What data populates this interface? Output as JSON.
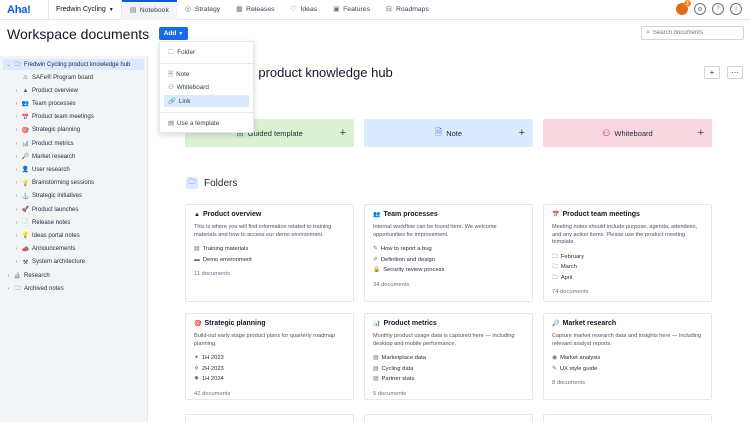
{
  "app": {
    "logo": "Aha!",
    "workspace": "Fredwin Cycling",
    "nav_tabs": [
      {
        "label": "Notebook",
        "icon": "notebook-icon",
        "glyph": "▤"
      },
      {
        "label": "Strategy",
        "icon": "strategy-icon",
        "glyph": "◎"
      },
      {
        "label": "Releases",
        "icon": "releases-icon",
        "glyph": "▦"
      },
      {
        "label": "Ideas",
        "icon": "lightbulb-icon",
        "glyph": "♡"
      },
      {
        "label": "Features",
        "icon": "features-icon",
        "glyph": "▣"
      },
      {
        "label": "Roadmaps",
        "icon": "roadmaps-icon",
        "glyph": "⊟"
      }
    ],
    "notifications_count": "1"
  },
  "header": {
    "title": "Workspace documents",
    "add_label": "Add",
    "search_placeholder": "Search documents"
  },
  "add_menu": {
    "folder": "Folder",
    "note": "Note",
    "whiteboard": "Whiteboard",
    "link": "Link",
    "template": "Use a template"
  },
  "sidebar": {
    "root": "Fredwin Cycling product knowledge hub",
    "items": [
      {
        "label": "SAFe® Program board",
        "glyph": "⚠",
        "color": "#6b7280",
        "chev": ""
      },
      {
        "label": "Product overview",
        "glyph": "▲",
        "color": "#1a6ae6",
        "chev": "›"
      },
      {
        "label": "Team processes",
        "glyph": "👥",
        "color": "#374151",
        "chev": "›"
      },
      {
        "label": "Product team meetings",
        "glyph": "📅",
        "color": "#b45309",
        "chev": "›"
      },
      {
        "label": "Strategic planning",
        "glyph": "🎯",
        "color": "#dc2626",
        "chev": "›"
      },
      {
        "label": "Product metrics",
        "glyph": "📊",
        "color": "#059669",
        "chev": "›"
      },
      {
        "label": "Market research",
        "glyph": "🔎",
        "color": "#374151",
        "chev": "›"
      },
      {
        "label": "User research",
        "glyph": "👤",
        "color": "#374151",
        "chev": "›"
      },
      {
        "label": "Brainstorming sessions",
        "glyph": "💡",
        "color": "#eab308",
        "chev": "›"
      },
      {
        "label": "Strategic initiatives",
        "glyph": "⚓",
        "color": "#374151",
        "chev": "›"
      },
      {
        "label": "Product launches",
        "glyph": "🚀",
        "color": "#dc2626",
        "chev": "›"
      },
      {
        "label": "Release notes",
        "glyph": "📄",
        "color": "#374151",
        "chev": "›"
      },
      {
        "label": "Ideas portal notes",
        "glyph": "💡",
        "color": "#eab308",
        "chev": "›"
      },
      {
        "label": "Announcements",
        "glyph": "📣",
        "color": "#374151",
        "chev": "›"
      },
      {
        "label": "System architecture",
        "glyph": "⚒",
        "color": "#374151",
        "chev": "›"
      }
    ],
    "top_level": [
      {
        "label": "Research",
        "glyph": "🔬"
      },
      {
        "label": "Archived notes",
        "glyph": "🗀"
      }
    ]
  },
  "main": {
    "title": "cling product knowledge hub",
    "create_cards": [
      {
        "label": "Guided template",
        "bg": "#dcf0d2",
        "icon": "guided-template-icon",
        "glyph": "⊞",
        "color": "#2f9e44"
      },
      {
        "label": "Note",
        "bg": "#dbeafe",
        "icon": "note-icon",
        "glyph": "🗎",
        "color": "#1a6ae6"
      },
      {
        "label": "Whiteboard",
        "bg": "#f9d7e0",
        "icon": "whiteboard-icon",
        "glyph": "⚇",
        "color": "#c2255c"
      }
    ],
    "folders_heading": "Folders",
    "folders": [
      {
        "title": "Product overview",
        "glyph": "▲",
        "desc": "This is where you will find information related to training materials and how to access our demo environment.",
        "items": [
          {
            "label": "Training materials",
            "glyph": "▤"
          },
          {
            "label": "Demo environment",
            "glyph": "▬"
          }
        ],
        "count": "11 documents"
      },
      {
        "title": "Team processes",
        "glyph": "👥",
        "desc": "Internal workflow can be found here. We welcome opportunities for improvement.",
        "items": [
          {
            "label": "How to report a bug",
            "glyph": "✎"
          },
          {
            "label": "Definition and design",
            "glyph": "✐"
          },
          {
            "label": "Security review process",
            "glyph": "🔒"
          }
        ],
        "count": "34 documents"
      },
      {
        "title": "Product team meetings",
        "glyph": "📅",
        "desc": "Meeting notes should include purpose, agenda, attendees, and any action items. Please use the product meeting template.",
        "items": [
          {
            "label": "February",
            "glyph": "🗀"
          },
          {
            "label": "March",
            "glyph": "🗀"
          },
          {
            "label": "April",
            "glyph": "🗀"
          }
        ],
        "count": "74 documents"
      },
      {
        "title": "Strategic planning",
        "glyph": "🎯",
        "desc": "Build-out early stage product plans for quarterly roadmap planning.",
        "items": [
          {
            "label": "1H 2023",
            "glyph": "✦"
          },
          {
            "label": "2H 2023",
            "glyph": "⚱"
          },
          {
            "label": "1H 2024",
            "glyph": "✸"
          }
        ],
        "count": "42 documents"
      },
      {
        "title": "Product metrics",
        "glyph": "📊",
        "desc": "Monthly product usage data is captured here — including desktop and mobile performance.",
        "items": [
          {
            "label": "Marketplace data",
            "glyph": "▤"
          },
          {
            "label": "Cycling data",
            "glyph": "▤"
          },
          {
            "label": "Partner stats",
            "glyph": "▤"
          }
        ],
        "count": "5 documents"
      },
      {
        "title": "Market research",
        "glyph": "🔎",
        "desc": "Capture market research data and insights here — including relevant analyst reports.",
        "items": [
          {
            "label": "Market analysis",
            "glyph": "◉"
          },
          {
            "label": "UX style guide",
            "glyph": "✎"
          }
        ],
        "count": "8 documents"
      }
    ]
  }
}
